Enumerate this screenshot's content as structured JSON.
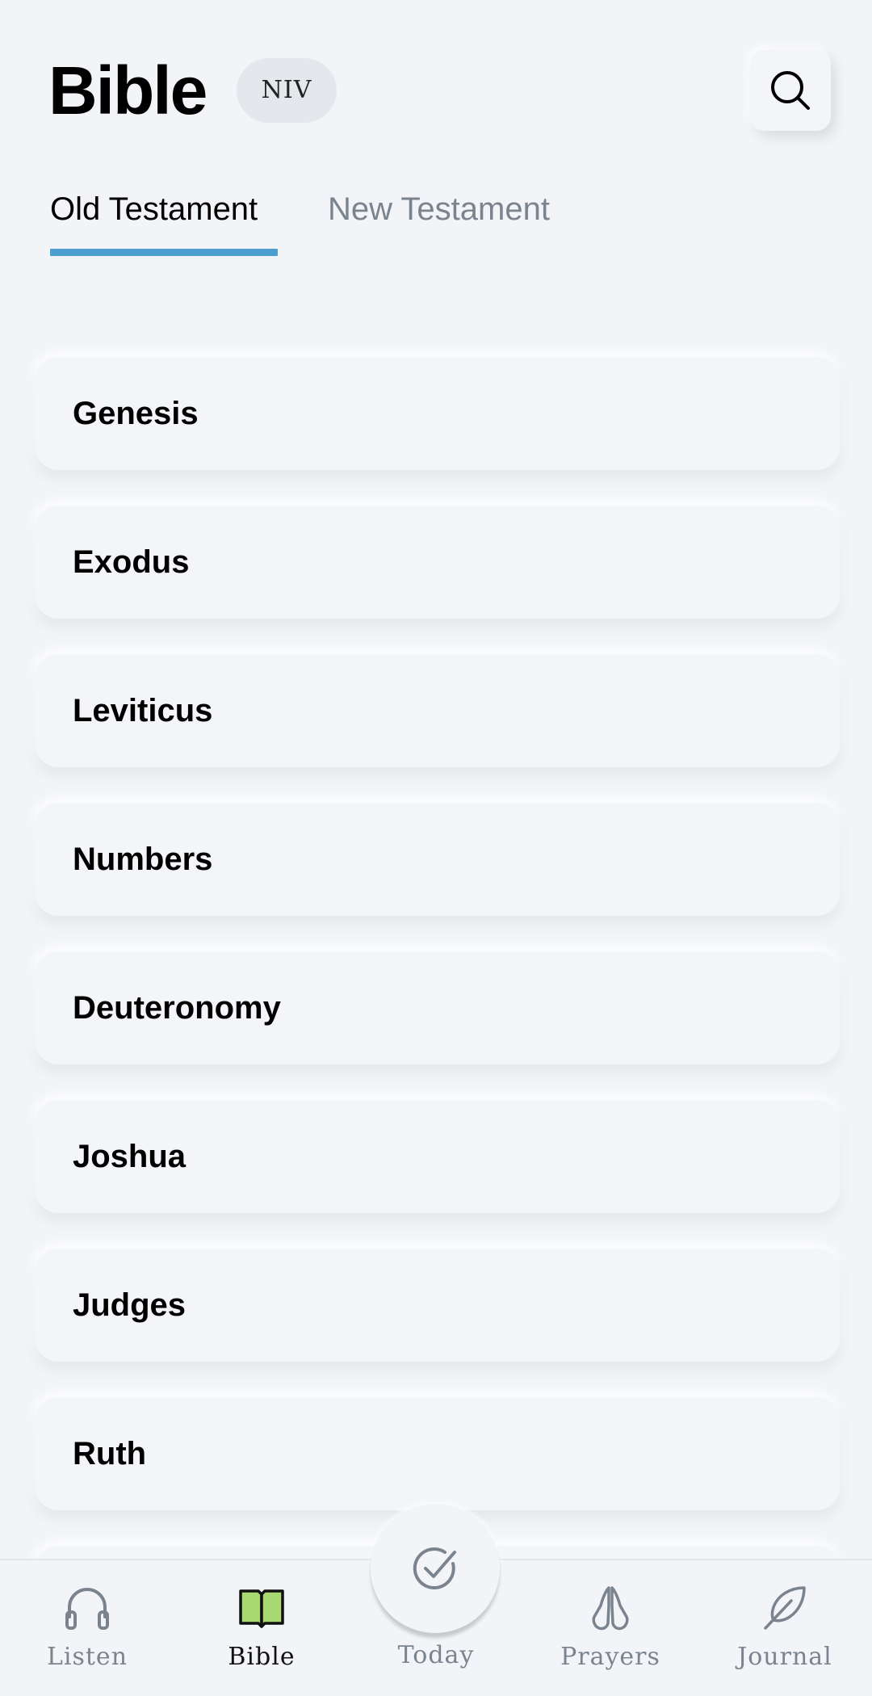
{
  "header": {
    "title": "Bible",
    "version": "NIV"
  },
  "tabs": {
    "old": "Old Testament",
    "new": "New Testament",
    "active": "old"
  },
  "books": [
    {
      "name": "Genesis"
    },
    {
      "name": "Exodus"
    },
    {
      "name": "Leviticus"
    },
    {
      "name": "Numbers"
    },
    {
      "name": "Deuteronomy"
    },
    {
      "name": "Joshua"
    },
    {
      "name": "Judges"
    },
    {
      "name": "Ruth"
    }
  ],
  "nav": {
    "listen": "Listen",
    "bible": "Bible",
    "today": "Today",
    "prayers": "Prayers",
    "journal": "Journal",
    "active": "bible"
  },
  "colors": {
    "accent": "#4a9fd0",
    "active_icon_fill": "#a8d872",
    "background": "#f2f4f7"
  },
  "icons": {
    "search": "search-icon",
    "listen": "headphones-icon",
    "bible": "open-book-icon",
    "today": "checkmark-circle-icon",
    "prayers": "praying-hands-icon",
    "journal": "feather-icon"
  }
}
